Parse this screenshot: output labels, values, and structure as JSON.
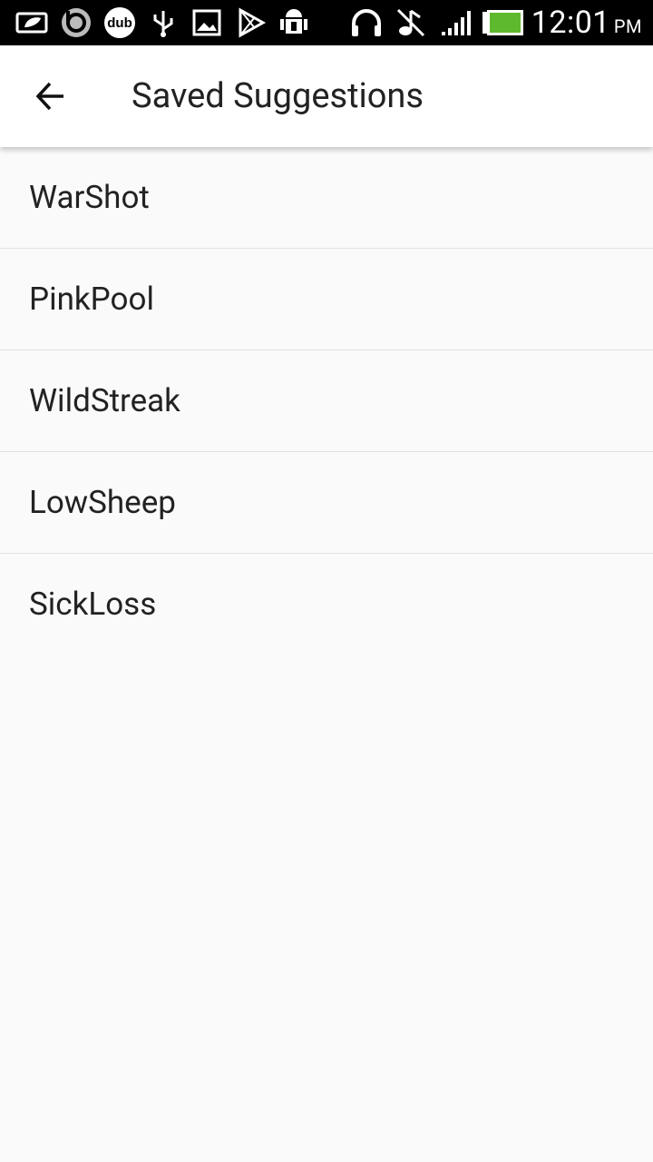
{
  "status_bar": {
    "time": "12:01",
    "ampm": "PM",
    "icons": [
      "photo-frame-icon",
      "beats-icon",
      "dub-icon",
      "usb-icon",
      "gallery-icon",
      "play-store-icon",
      "android-debug-icon",
      "headphones-icon",
      "music-muted-icon",
      "signal-icon",
      "battery-icon"
    ],
    "battery_color": "#5fb92e"
  },
  "app_bar": {
    "title": "Saved Suggestions",
    "back_icon": "arrow-back-icon"
  },
  "list": {
    "items": [
      "WarShot",
      "PinkPool",
      "WildStreak",
      "LowSheep",
      "SickLoss"
    ]
  }
}
